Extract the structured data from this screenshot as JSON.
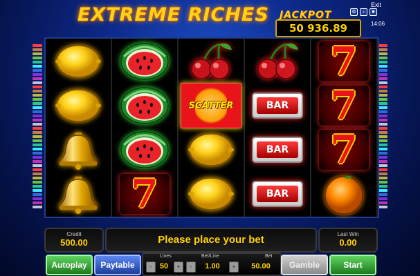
{
  "game": {
    "title": "EXTREME RICHES",
    "jackpot_label": "JACKPOT",
    "jackpot_value": "50 936.89",
    "exit_label": "Exit",
    "clock": "14:06"
  },
  "reels": [
    [
      "lemon",
      "lemon",
      "bell",
      "bell"
    ],
    [
      "watermelon",
      "watermelon",
      "watermelon",
      "seven"
    ],
    [
      "cherries",
      "scatter",
      "lemon",
      "lemon"
    ],
    [
      "cherries",
      "bar",
      "bar",
      "bar"
    ],
    [
      "seven",
      "seven",
      "seven",
      "orange"
    ]
  ],
  "symbols": {
    "scatter_label": "SCATTER",
    "bar_label": "BAR",
    "seven_label": "7"
  },
  "info": {
    "credit_label": "Credit",
    "credit_value": "500.00",
    "message": "Please place your bet",
    "last_win_label": "Last Win",
    "last_win_value": "0.00"
  },
  "controls": {
    "autoplay": "Autoplay",
    "paytable": "Paytable",
    "lines_label": "Lines",
    "lines_value": "50",
    "bet_line_label": "Bet/Line",
    "bet_line_value": "1.00",
    "bet_label": "Bet",
    "bet_value": "50.00",
    "gamble": "Gamble",
    "start": "Start",
    "minus": "-",
    "plus": "+"
  },
  "colors": {
    "gold": "#ffd200",
    "start_green": "#2fa82f",
    "paytable_blue": "#2b57c9"
  }
}
